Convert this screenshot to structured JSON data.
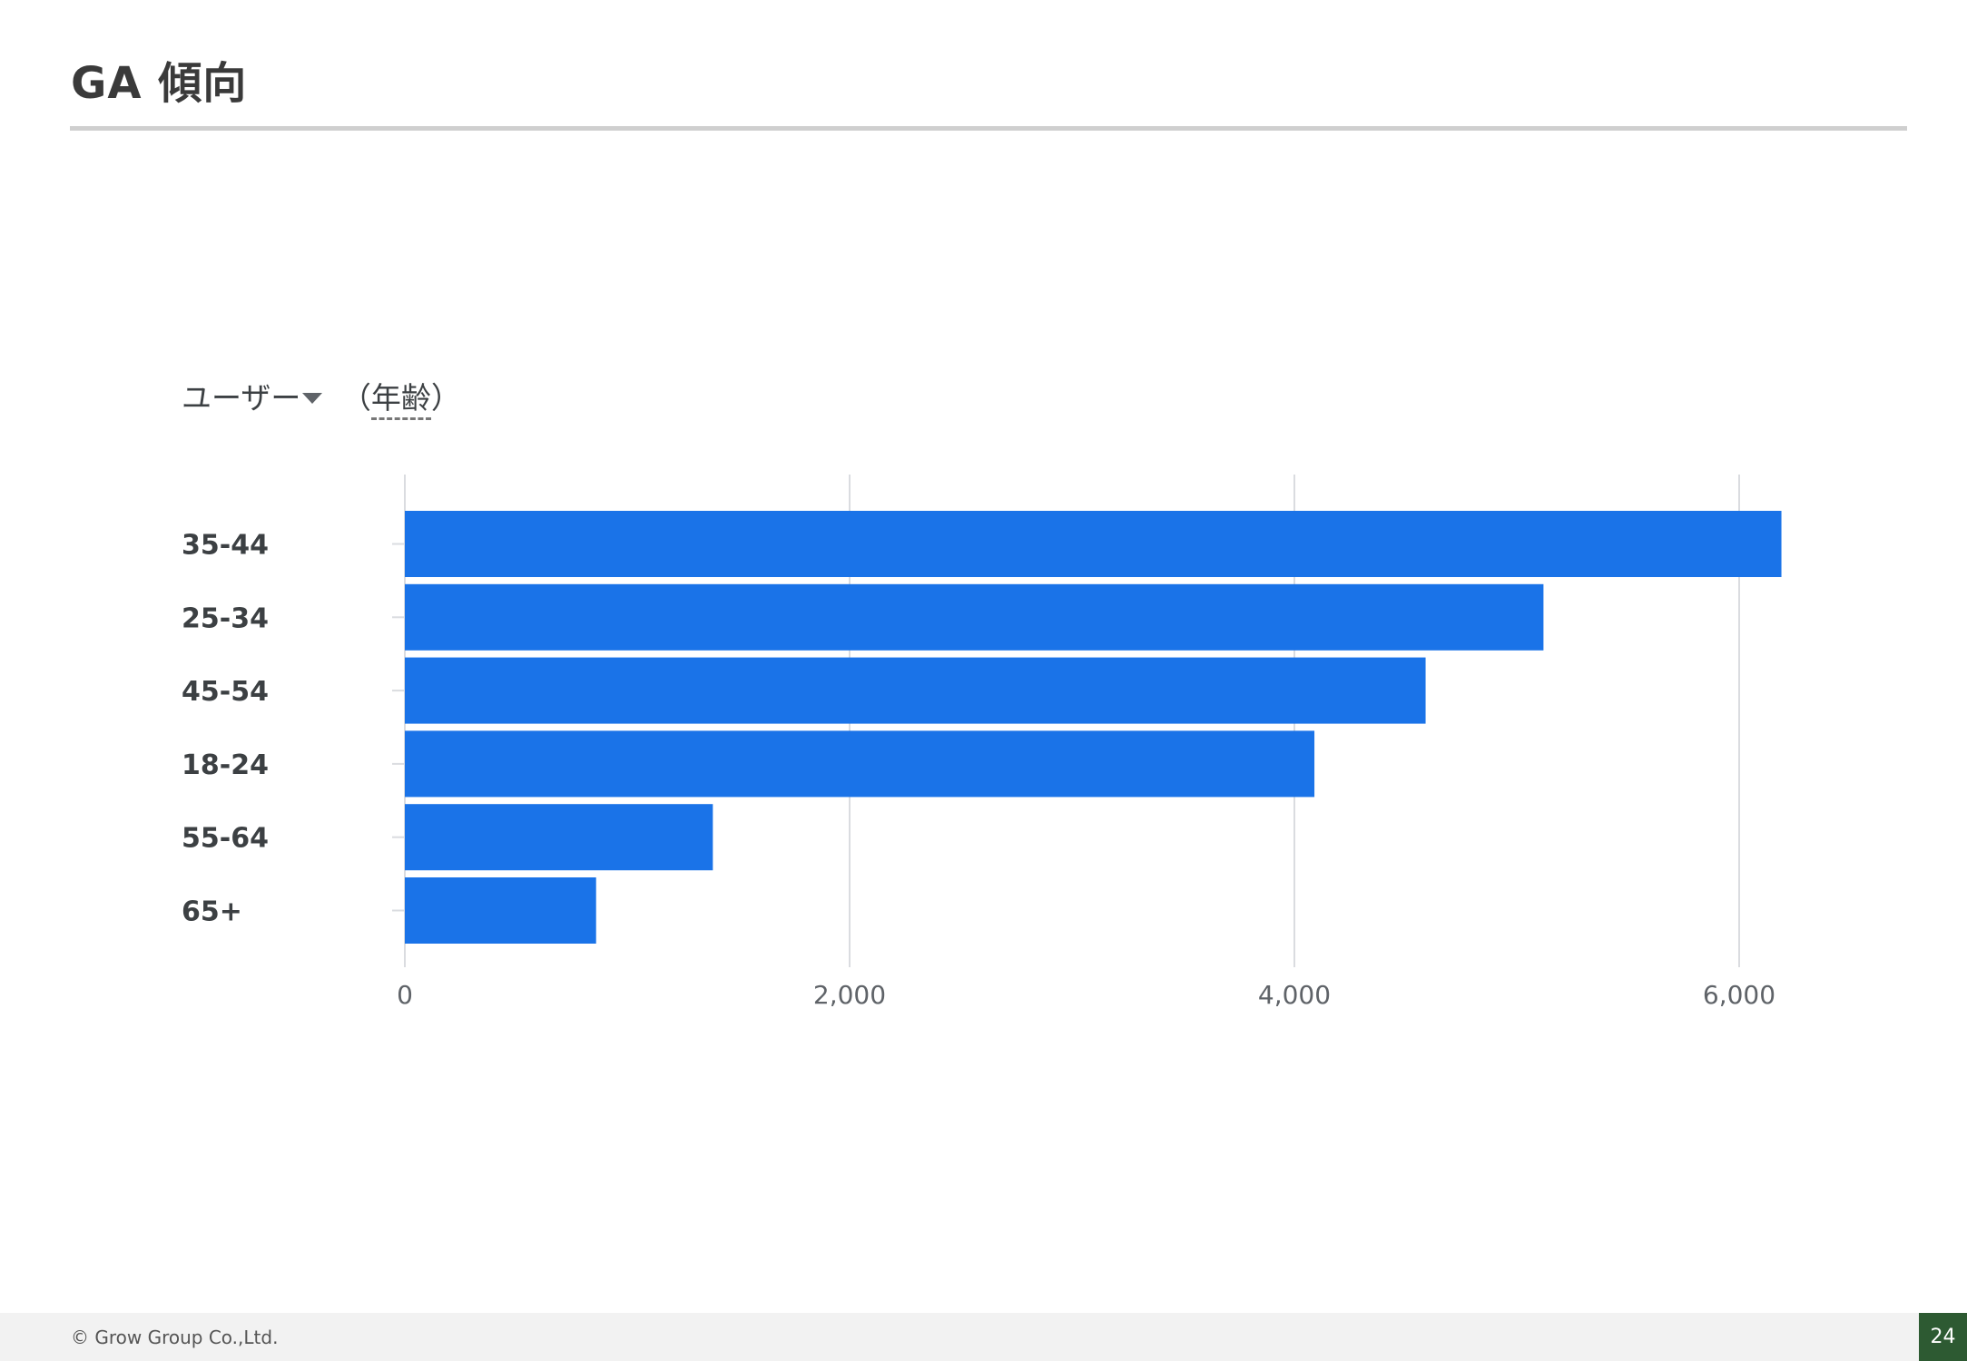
{
  "slide": {
    "title": "GA 傾向",
    "footer": "© Grow Group Co.,Ltd.",
    "page_number": "24"
  },
  "chart_header": {
    "metric": "ユーザー",
    "dimension_open": "（",
    "dimension": "年齢",
    "dimension_close": "）"
  },
  "colors": {
    "bar": "#1a73e8",
    "gridline": "#dadce0",
    "rule": "#cfcfcf",
    "page_badge": "#2d5a32"
  },
  "chart_data": {
    "type": "bar",
    "orientation": "horizontal",
    "categories": [
      "35-44",
      "25-34",
      "45-54",
      "18-24",
      "55-64",
      "65+"
    ],
    "values": [
      6190,
      5120,
      4590,
      4090,
      1385,
      860
    ],
    "xlim": [
      0,
      6700
    ],
    "xticks": [
      0,
      2000,
      4000,
      6000
    ],
    "xtick_labels": [
      "0",
      "2,000",
      "4,000",
      "6,000"
    ],
    "grid": true
  }
}
